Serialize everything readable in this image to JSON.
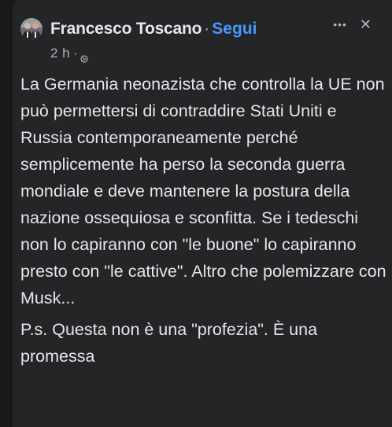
{
  "post": {
    "author": "Francesco Toscano",
    "separator": "·",
    "follow_label": "Segui",
    "time": "2 h",
    "meta_separator": "·",
    "privacy_icon": "globe-icon",
    "more_icon": "more-options-icon",
    "close_icon": "close-icon",
    "paragraphs": [
      "La Germania neonazista che controlla la UE non può permettersi di contraddire Stati Uniti e Russia contemporaneamente perché semplicemente ha perso la seconda guerra mondiale e deve mantenere la postura della nazione ossequiosa e sconfitta. Se i tedeschi non lo capiranno con \"le buone\" lo capiranno presto con \"le cattive\". Altro che polemizzare con Musk...",
      "P.s. Questa non è una \"profezia\". È una promessa"
    ]
  },
  "colors": {
    "background": "#18191a",
    "card": "#242526",
    "text": "#e4e6eb",
    "secondary_text": "#b0b3b8",
    "link": "#4599ff"
  }
}
